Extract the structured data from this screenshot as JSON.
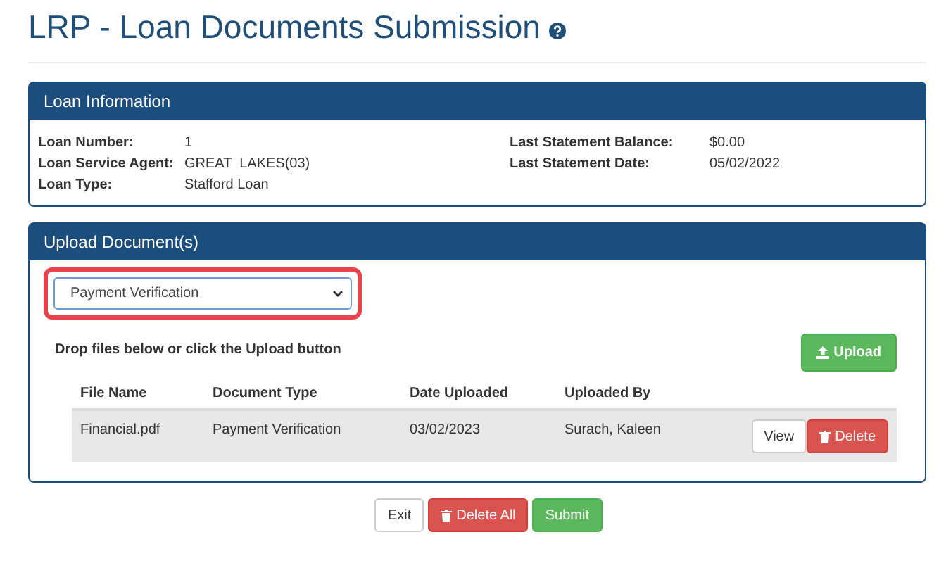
{
  "page": {
    "title": "LRP - Loan Documents Submission"
  },
  "loan_information": {
    "title": "Loan Information",
    "left": [
      {
        "label": "Loan Number:",
        "value": "1"
      },
      {
        "label": "Loan Service Agent:",
        "value": "GREAT  LAKES(03)"
      },
      {
        "label": "Loan Type:",
        "value": "Stafford Loan"
      }
    ],
    "right": [
      {
        "label": "Last Statement  Balance:",
        "value": "$0.00"
      },
      {
        "label": "Last Statement Date:",
        "value": "05/02/2022"
      }
    ]
  },
  "upload": {
    "title": "Upload Document(s)",
    "document_select": {
      "value": "Payment Verification",
      "highlighted": true
    },
    "hint": "Drop files below or click the Upload button",
    "upload_button": "Upload",
    "table": {
      "columns": [
        "File Name",
        "Document Type",
        "Date Uploaded",
        "Uploaded By"
      ],
      "rows": [
        {
          "cells": [
            "Financial.pdf",
            "Payment Verification",
            "03/02/2023",
            "Surach, Kaleen"
          ],
          "actions": [
            "View",
            "Delete"
          ]
        }
      ]
    }
  },
  "footer_buttons": [
    {
      "label": "Exit",
      "kind": "default"
    },
    {
      "label": "Delete All",
      "kind": "danger"
    },
    {
      "label": "Submit",
      "kind": "success"
    }
  ]
}
